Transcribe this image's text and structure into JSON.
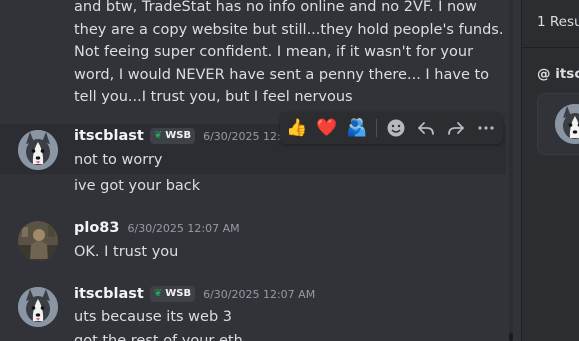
{
  "chat": {
    "previous_message_lines": [
      "and btw, TradeStat has no info online and no 2VF.  I now",
      "they are a copy website but still...they hold people's funds.",
      "Not feeing super confident.  I mean, if it wasn't for your",
      "word, I would NEVER have sent a penny there...  I have to",
      "tell you...I trust you, but I feel nervous"
    ],
    "messages": [
      {
        "author": "itscblast",
        "tag": "WSB",
        "timestamp": "6/30/2025 12:06",
        "lines": [
          "not to worry",
          "ive got your back"
        ]
      },
      {
        "author": "plo83",
        "timestamp": "6/30/2025 12:07 AM",
        "lines": [
          "OK.  I trust you"
        ]
      },
      {
        "author": "itscblast",
        "tag": "WSB",
        "timestamp": "6/30/2025 12:07 AM",
        "lines": [
          "uts because its web 3",
          "got the rest of your eth"
        ]
      }
    ],
    "toolbar": {
      "reactions": [
        "👍",
        "❤️",
        "🫂"
      ],
      "add_reaction_icon": "emoji-icon",
      "reply_icon": "reply-icon",
      "forward_icon": "forward-icon",
      "more_icon": "more-icon"
    }
  },
  "search_panel": {
    "result_count": "1 Resu",
    "channel": "@ itsc"
  },
  "colors": {
    "background": "#323339",
    "panel": "#2b2d31",
    "text": "#dbdee1",
    "muted": "#949ba4",
    "tag_icon": "#23a55a"
  }
}
